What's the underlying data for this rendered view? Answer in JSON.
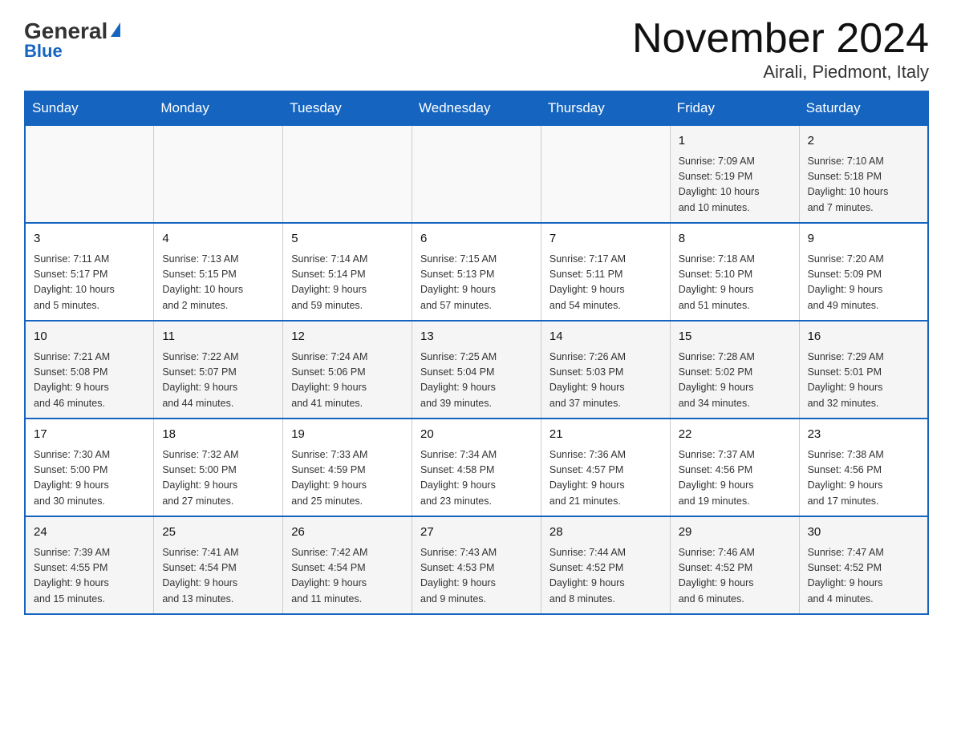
{
  "header": {
    "logo": {
      "general": "General",
      "blue": "Blue"
    },
    "title": "November 2024",
    "location": "Airali, Piedmont, Italy"
  },
  "weekdays": [
    "Sunday",
    "Monday",
    "Tuesday",
    "Wednesday",
    "Thursday",
    "Friday",
    "Saturday"
  ],
  "weeks": [
    {
      "bg": "light",
      "days": [
        {
          "day": "",
          "info": ""
        },
        {
          "day": "",
          "info": ""
        },
        {
          "day": "",
          "info": ""
        },
        {
          "day": "",
          "info": ""
        },
        {
          "day": "",
          "info": ""
        },
        {
          "day": "1",
          "info": "Sunrise: 7:09 AM\nSunset: 5:19 PM\nDaylight: 10 hours\nand 10 minutes."
        },
        {
          "day": "2",
          "info": "Sunrise: 7:10 AM\nSunset: 5:18 PM\nDaylight: 10 hours\nand 7 minutes."
        }
      ]
    },
    {
      "bg": "white",
      "days": [
        {
          "day": "3",
          "info": "Sunrise: 7:11 AM\nSunset: 5:17 PM\nDaylight: 10 hours\nand 5 minutes."
        },
        {
          "day": "4",
          "info": "Sunrise: 7:13 AM\nSunset: 5:15 PM\nDaylight: 10 hours\nand 2 minutes."
        },
        {
          "day": "5",
          "info": "Sunrise: 7:14 AM\nSunset: 5:14 PM\nDaylight: 9 hours\nand 59 minutes."
        },
        {
          "day": "6",
          "info": "Sunrise: 7:15 AM\nSunset: 5:13 PM\nDaylight: 9 hours\nand 57 minutes."
        },
        {
          "day": "7",
          "info": "Sunrise: 7:17 AM\nSunset: 5:11 PM\nDaylight: 9 hours\nand 54 minutes."
        },
        {
          "day": "8",
          "info": "Sunrise: 7:18 AM\nSunset: 5:10 PM\nDaylight: 9 hours\nand 51 minutes."
        },
        {
          "day": "9",
          "info": "Sunrise: 7:20 AM\nSunset: 5:09 PM\nDaylight: 9 hours\nand 49 minutes."
        }
      ]
    },
    {
      "bg": "light",
      "days": [
        {
          "day": "10",
          "info": "Sunrise: 7:21 AM\nSunset: 5:08 PM\nDaylight: 9 hours\nand 46 minutes."
        },
        {
          "day": "11",
          "info": "Sunrise: 7:22 AM\nSunset: 5:07 PM\nDaylight: 9 hours\nand 44 minutes."
        },
        {
          "day": "12",
          "info": "Sunrise: 7:24 AM\nSunset: 5:06 PM\nDaylight: 9 hours\nand 41 minutes."
        },
        {
          "day": "13",
          "info": "Sunrise: 7:25 AM\nSunset: 5:04 PM\nDaylight: 9 hours\nand 39 minutes."
        },
        {
          "day": "14",
          "info": "Sunrise: 7:26 AM\nSunset: 5:03 PM\nDaylight: 9 hours\nand 37 minutes."
        },
        {
          "day": "15",
          "info": "Sunrise: 7:28 AM\nSunset: 5:02 PM\nDaylight: 9 hours\nand 34 minutes."
        },
        {
          "day": "16",
          "info": "Sunrise: 7:29 AM\nSunset: 5:01 PM\nDaylight: 9 hours\nand 32 minutes."
        }
      ]
    },
    {
      "bg": "white",
      "days": [
        {
          "day": "17",
          "info": "Sunrise: 7:30 AM\nSunset: 5:00 PM\nDaylight: 9 hours\nand 30 minutes."
        },
        {
          "day": "18",
          "info": "Sunrise: 7:32 AM\nSunset: 5:00 PM\nDaylight: 9 hours\nand 27 minutes."
        },
        {
          "day": "19",
          "info": "Sunrise: 7:33 AM\nSunset: 4:59 PM\nDaylight: 9 hours\nand 25 minutes."
        },
        {
          "day": "20",
          "info": "Sunrise: 7:34 AM\nSunset: 4:58 PM\nDaylight: 9 hours\nand 23 minutes."
        },
        {
          "day": "21",
          "info": "Sunrise: 7:36 AM\nSunset: 4:57 PM\nDaylight: 9 hours\nand 21 minutes."
        },
        {
          "day": "22",
          "info": "Sunrise: 7:37 AM\nSunset: 4:56 PM\nDaylight: 9 hours\nand 19 minutes."
        },
        {
          "day": "23",
          "info": "Sunrise: 7:38 AM\nSunset: 4:56 PM\nDaylight: 9 hours\nand 17 minutes."
        }
      ]
    },
    {
      "bg": "light",
      "days": [
        {
          "day": "24",
          "info": "Sunrise: 7:39 AM\nSunset: 4:55 PM\nDaylight: 9 hours\nand 15 minutes."
        },
        {
          "day": "25",
          "info": "Sunrise: 7:41 AM\nSunset: 4:54 PM\nDaylight: 9 hours\nand 13 minutes."
        },
        {
          "day": "26",
          "info": "Sunrise: 7:42 AM\nSunset: 4:54 PM\nDaylight: 9 hours\nand 11 minutes."
        },
        {
          "day": "27",
          "info": "Sunrise: 7:43 AM\nSunset: 4:53 PM\nDaylight: 9 hours\nand 9 minutes."
        },
        {
          "day": "28",
          "info": "Sunrise: 7:44 AM\nSunset: 4:52 PM\nDaylight: 9 hours\nand 8 minutes."
        },
        {
          "day": "29",
          "info": "Sunrise: 7:46 AM\nSunset: 4:52 PM\nDaylight: 9 hours\nand 6 minutes."
        },
        {
          "day": "30",
          "info": "Sunrise: 7:47 AM\nSunset: 4:52 PM\nDaylight: 9 hours\nand 4 minutes."
        }
      ]
    }
  ]
}
